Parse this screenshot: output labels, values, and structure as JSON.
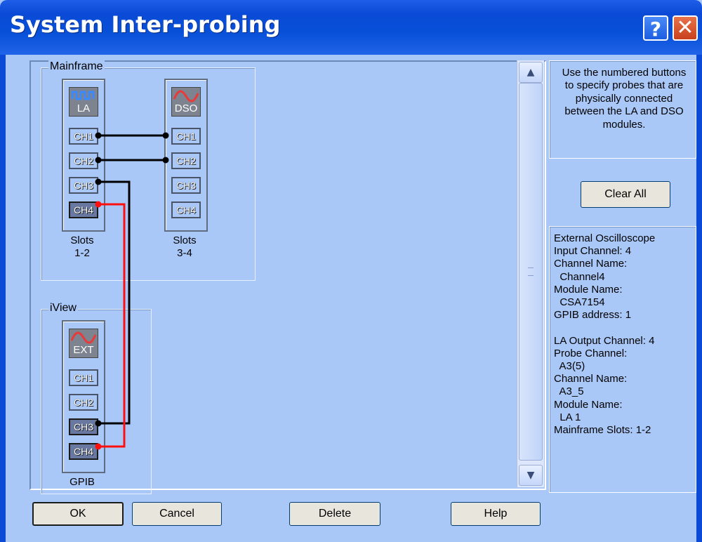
{
  "window": {
    "title": "System Inter-probing",
    "help_label": "?",
    "close_label": "✕"
  },
  "mainframe": {
    "group_label": "Mainframe",
    "la_module": {
      "icon_text": "LA",
      "channels": [
        "CH1",
        "CH2",
        "CH3",
        "CH4"
      ],
      "slots_label": "Slots",
      "slots_value": "1-2"
    },
    "dso_module": {
      "icon_text": "DSO",
      "channels": [
        "CH1",
        "CH2",
        "CH3",
        "CH4"
      ],
      "slots_label": "Slots",
      "slots_value": "3-4"
    }
  },
  "iview": {
    "group_label": "iView",
    "ext_module": {
      "icon_text": "EXT",
      "channels": [
        "CH1",
        "CH2",
        "CH3",
        "CH4"
      ],
      "label": "GPIB"
    }
  },
  "info_panel": {
    "text": "Use the numbered buttons to specify probes that are physically connected between the LA and DSO modules."
  },
  "buttons": {
    "clear_all": "Clear All",
    "ok": "OK",
    "cancel": "Cancel",
    "delete": "Delete",
    "help": "Help"
  },
  "details": {
    "text": "External Oscilloscope\nInput Channel: 4\nChannel Name:\n  Channel4\nModule Name:\n  CSA7154\nGPIB address: 1\n\nLA Output Channel: 4\nProbe Channel:\n  A3(5)\nChannel Name:\n  A3_5\nModule Name:\n  LA 1\nMainframe Slots: 1-2"
  },
  "colors": {
    "background": "#a9c8f8",
    "titlebar": "#0a4ad6",
    "wire_black": "#000000",
    "wire_red": "#ff1010"
  }
}
